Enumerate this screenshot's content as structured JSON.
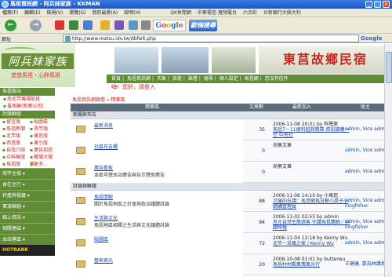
{
  "window": {
    "title": "馬祖資訊網 - 阿兵妹家族 - KKMAN"
  },
  "menu": [
    "檔案(F)",
    "編輯(E)",
    "檢視(V)",
    "瀏覽(G)",
    "我的最愛(A)",
    "說明(H)"
  ],
  "quicklinks": [
    "QK休閒網",
    "中華電信-寬頻電台",
    "六合彩",
    "台新銀行大鼎大利"
  ],
  "toolbar": {
    "back": "←",
    "forward": "→",
    "search_brand_google": "Google",
    "search_brand_cn": "歐嗨搜尋"
  },
  "address": {
    "label": "網址",
    "url": "http://www.matsu.idv.tw/dbfwlt.php",
    "google": "Google"
  },
  "banner": {
    "brand": "阿兵妹家族",
    "slogan": "悠悠馬祖・心醉馬祖",
    "sign": "東莒故鄉民宿"
  },
  "nav": [
    "首頁",
    "馬祖資訊網",
    "天氣",
    "旅遊",
    "論壇",
    "搜尋",
    "個人設定",
    "馬祖網",
    "您沒有信件"
  ],
  "sidebar": {
    "head1": "馬祖版站",
    "items1": [
      "南北竿機場航班",
      "臺馬輪(新華公司)"
    ],
    "head2": "討論群組",
    "grid": [
      "留言版",
      "貼圖區",
      "馬祖新聞",
      "南竿版",
      "北竿版",
      "東莒版",
      "西莒版",
      "東引版",
      "自我介紹",
      "廣告招商",
      "兵科聯誼",
      "職場大搜索",
      "馬祖版",
      "更多..."
    ],
    "buttons": [
      "南竿住宿",
      "食在住行",
      "特產與餐廳",
      "軍旅聯絡",
      "線上資訊",
      "相關連結",
      "本站專區"
    ],
    "hotrank": "HOTRANK"
  },
  "main": {
    "greeting": "嗨！您好，請登入",
    "breadcrumb": "馬祖資訊網論壇 » 精華區",
    "headers": {
      "forum": "精華區",
      "topics": "文章數",
      "last": "最新加入",
      "mods": "版主"
    },
    "sections": [
      {
        "title": "新聞與布告",
        "rows": [
          {
            "name": "最新消息",
            "desc": "",
            "count": "35",
            "last_time": "2006-11-08 20:31 by 科學家",
            "last_title": "馬祖7－11便利超商開幕 資訊搶購一空 中央社",
            "mods": "admin, Vice admin"
          },
          {
            "name": "社區布告欄",
            "desc": "",
            "count": "0",
            "last_time": "尚無文章",
            "last_title": "",
            "mods": "admin, Vice admin"
          },
          {
            "name": "廣告看板",
            "desc": "本區可撰本站廣告與告示贊助廣告",
            "count": "0",
            "last_time": "尚無文章",
            "last_title": "",
            "mods": "admin, Vice admin"
          }
        ]
      },
      {
        "title": "討論與聯誼",
        "rows": [
          {
            "name": "馬祖閒聊",
            "desc": "關於馬祖地區之社會與政治議題討論",
            "count": "88",
            "last_time": "2006-11-06 14:10 by 小馬民",
            "last_title": "沉痛的抗議：馬資網馬日郵小昌子小網購管理員",
            "mods": "admin, Vice admin, kingfisher"
          },
          {
            "name": "生活與文化",
            "desc": "馬祖地區相關之生活與文化議題討論",
            "count": "84",
            "last_time": "2006-11-02 02:55 by admin",
            "last_title": "莒光自然生態遊客 守護馬祖鵲鯨／中國時報",
            "mods": "admin, Vice admin, kingfisher"
          },
          {
            "name": "貼圖區",
            "desc": "",
            "count": "72",
            "last_time": "2006-11-04 12:18 by Kenny Wu",
            "last_title": "北竿－采風之家 / Kenny Wu",
            "mods": "admin, Vice admin"
          },
          {
            "name": "藝術寫光",
            "desc": "",
            "count": "20",
            "last_time": "2006-10-08 01:01 by butterwu",
            "last_title": "馬祖村村觀風情風光行",
            "mods": "王健康, 鄭為林講員"
          }
        ]
      }
    ]
  }
}
